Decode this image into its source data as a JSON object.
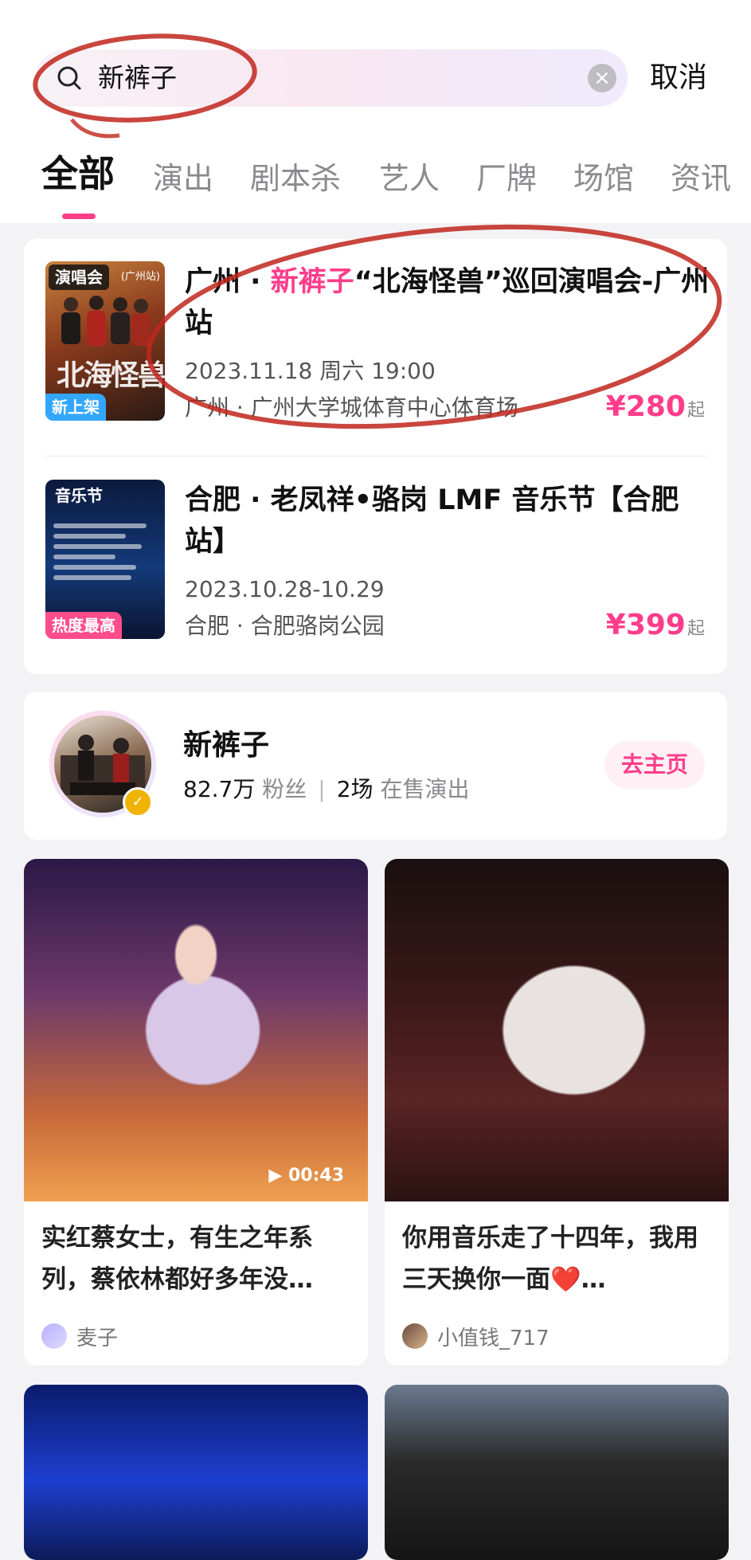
{
  "search": {
    "value": "新裤子",
    "clear_icon": "clear-icon",
    "cancel_label": "取消"
  },
  "tabs": [
    "全部",
    "演出",
    "剧本杀",
    "艺人",
    "厂牌",
    "场馆",
    "资讯"
  ],
  "accent_color": "#ff3d8a",
  "shows": [
    {
      "poster_tag": "演唱会",
      "poster_city": "(广州站)",
      "poster_art": "北海怪兽",
      "badge": "新上架",
      "title_prefix": "广州 · ",
      "title_highlight": "新裤子",
      "title_rest": "“北海怪兽”巡回演唱会-广州站",
      "date": "2023.11.18 周六 19:00",
      "venue": "广州 · 广州大学城体育中心体育场",
      "price": "¥280",
      "price_suffix": "起"
    },
    {
      "poster_tag": "音乐节",
      "badge": "热度最高",
      "title_prefix": "合肥 · 老凤祥•骆岗 LMF 音乐节【合肥站】",
      "date": "2023.10.28-10.29",
      "venue": "合肥 · 合肥骆岗公园",
      "price": "¥399",
      "price_suffix": "起"
    }
  ],
  "artist": {
    "name": "新裤子",
    "fans_count": "82.7万",
    "fans_label": "粉丝",
    "shows_count": "2场",
    "shows_label": "在售演出",
    "homepage_label": "去主页"
  },
  "feed": [
    {
      "duration": "00:43",
      "title": "实红蔡女士，有生之年系列，蔡依林都好多年没…",
      "user": "麦子"
    },
    {
      "title": "你用音乐走了十四年，我用三天换你一面❤️…",
      "user": "小值钱_717"
    }
  ]
}
